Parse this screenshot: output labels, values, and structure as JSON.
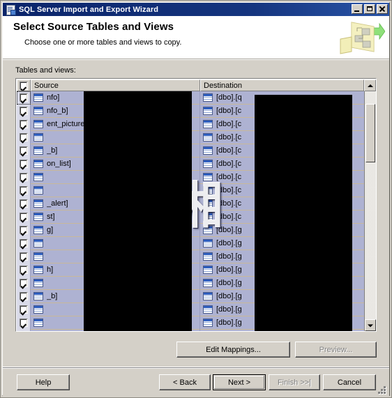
{
  "window": {
    "title": "SQL Server Import and Export Wizard",
    "icon": "wizard-document-icon",
    "controls": {
      "minimize": "Minimize",
      "maximize": "Maximize",
      "close": "Close"
    }
  },
  "banner": {
    "title": "Select Source Tables and Views",
    "subtitle": "Choose one or more tables and views to copy.",
    "art": "data-flow-diagram-icon"
  },
  "content": {
    "tables_label": "Tables and views:",
    "watermark": "潇湘"
  },
  "grid": {
    "header_checkbox_checked": true,
    "columns": [
      {
        "key": "check",
        "label": ""
      },
      {
        "key": "source",
        "label": "Source"
      },
      {
        "key": "destination",
        "label": "Destination"
      }
    ],
    "rows": [
      {
        "checked": true,
        "source": "nfo]",
        "destination": "[dbo].[q"
      },
      {
        "checked": true,
        "source": "nfo_b]",
        "destination": "[dbo].[c"
      },
      {
        "checked": true,
        "source": "ent_picture]",
        "destination": "[dbo].[c"
      },
      {
        "checked": true,
        "source": "",
        "destination": "[dbo].[c"
      },
      {
        "checked": true,
        "source": "_b]",
        "destination": "[dbo].[c"
      },
      {
        "checked": true,
        "source": "on_list]",
        "destination": "[dbo].[c"
      },
      {
        "checked": true,
        "source": "",
        "destination": "[dbo].[c"
      },
      {
        "checked": true,
        "source": "",
        "destination": "[dbo].[c"
      },
      {
        "checked": true,
        "source": "_alert]",
        "destination": "[dbo].[c"
      },
      {
        "checked": true,
        "source": "st]",
        "destination": "[dbo].[c"
      },
      {
        "checked": true,
        "source": "g]",
        "destination": "[dbo].[g"
      },
      {
        "checked": true,
        "source": "",
        "destination": "[dbo].[g"
      },
      {
        "checked": true,
        "source": "",
        "destination": "[dbo].[g"
      },
      {
        "checked": true,
        "source": "h]",
        "destination": "[dbo].[g"
      },
      {
        "checked": true,
        "source": "",
        "destination": "[dbo].[g"
      },
      {
        "checked": true,
        "source": "_b]",
        "destination": "[dbo].[g"
      },
      {
        "checked": true,
        "source": "",
        "destination": "[dbo].[g"
      },
      {
        "checked": true,
        "source": "",
        "destination": "[dbo].[g"
      },
      {
        "checked": true,
        "source": "",
        "destination": "[dbo].[g"
      }
    ],
    "row_icon": "table-icon",
    "scrollbar": {
      "up_icon": "scroll-up-arrow-icon",
      "down_icon": "scroll-down-arrow-icon"
    }
  },
  "mapping_buttons": {
    "edit_mappings": {
      "label": "Edit Mappings...",
      "enabled": true
    },
    "preview": {
      "label": "Preview...",
      "enabled": false
    }
  },
  "footer": {
    "help": {
      "label": "Help",
      "enabled": true,
      "default": false
    },
    "back": {
      "label": "< Back",
      "enabled": true,
      "default": false
    },
    "next": {
      "label": "Next >",
      "enabled": true,
      "default": true
    },
    "finish": {
      "label": "Finish >>|",
      "enabled": false,
      "default": false
    },
    "cancel": {
      "label": "Cancel",
      "enabled": true,
      "default": false
    }
  },
  "colors": {
    "titlebar": "#0a246a",
    "face": "#d4d0c8",
    "row_selected": "#aeb2d2",
    "row_gridline": "#c8b89a",
    "redaction": "#000000"
  }
}
